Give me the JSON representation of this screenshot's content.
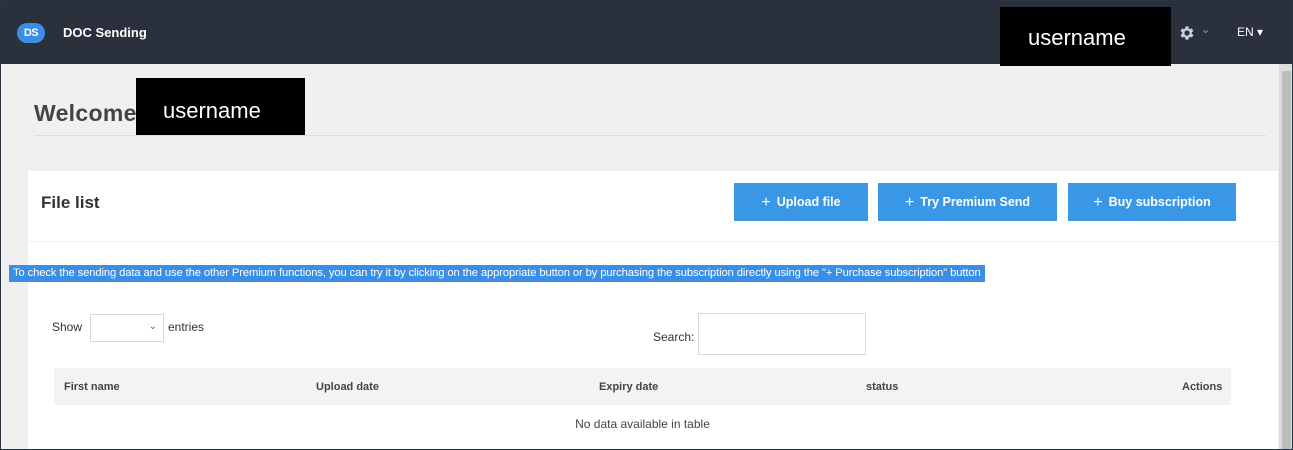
{
  "navbar": {
    "logo_text": "DS",
    "app_title": "DOC Sending",
    "username": "username",
    "settings_caret": "⌄",
    "language": "EN ▾"
  },
  "welcome": {
    "title": "Welcome",
    "username": "username"
  },
  "file_list": {
    "title": "File list",
    "buttons": {
      "upload": "Upload file",
      "premium": "Try Premium Send",
      "buy": "Buy subscription"
    },
    "plus": "+",
    "notice": "To check the sending data and use the other Premium functions, you can try it by clicking on the appropriate button or by purchasing the subscription directly using the \"+ Purchase subscription\" button"
  },
  "table_controls": {
    "show_label": "Show",
    "entries_label": "entries",
    "entries_caret": "⌄",
    "search_label": "Search:"
  },
  "table": {
    "columns": [
      "First name",
      "Upload date",
      "Expiry date",
      "status",
      "Actions"
    ],
    "empty_message": "No data available in table"
  },
  "colors": {
    "navbar": "#2a313c",
    "accent": "#3a97e6"
  }
}
